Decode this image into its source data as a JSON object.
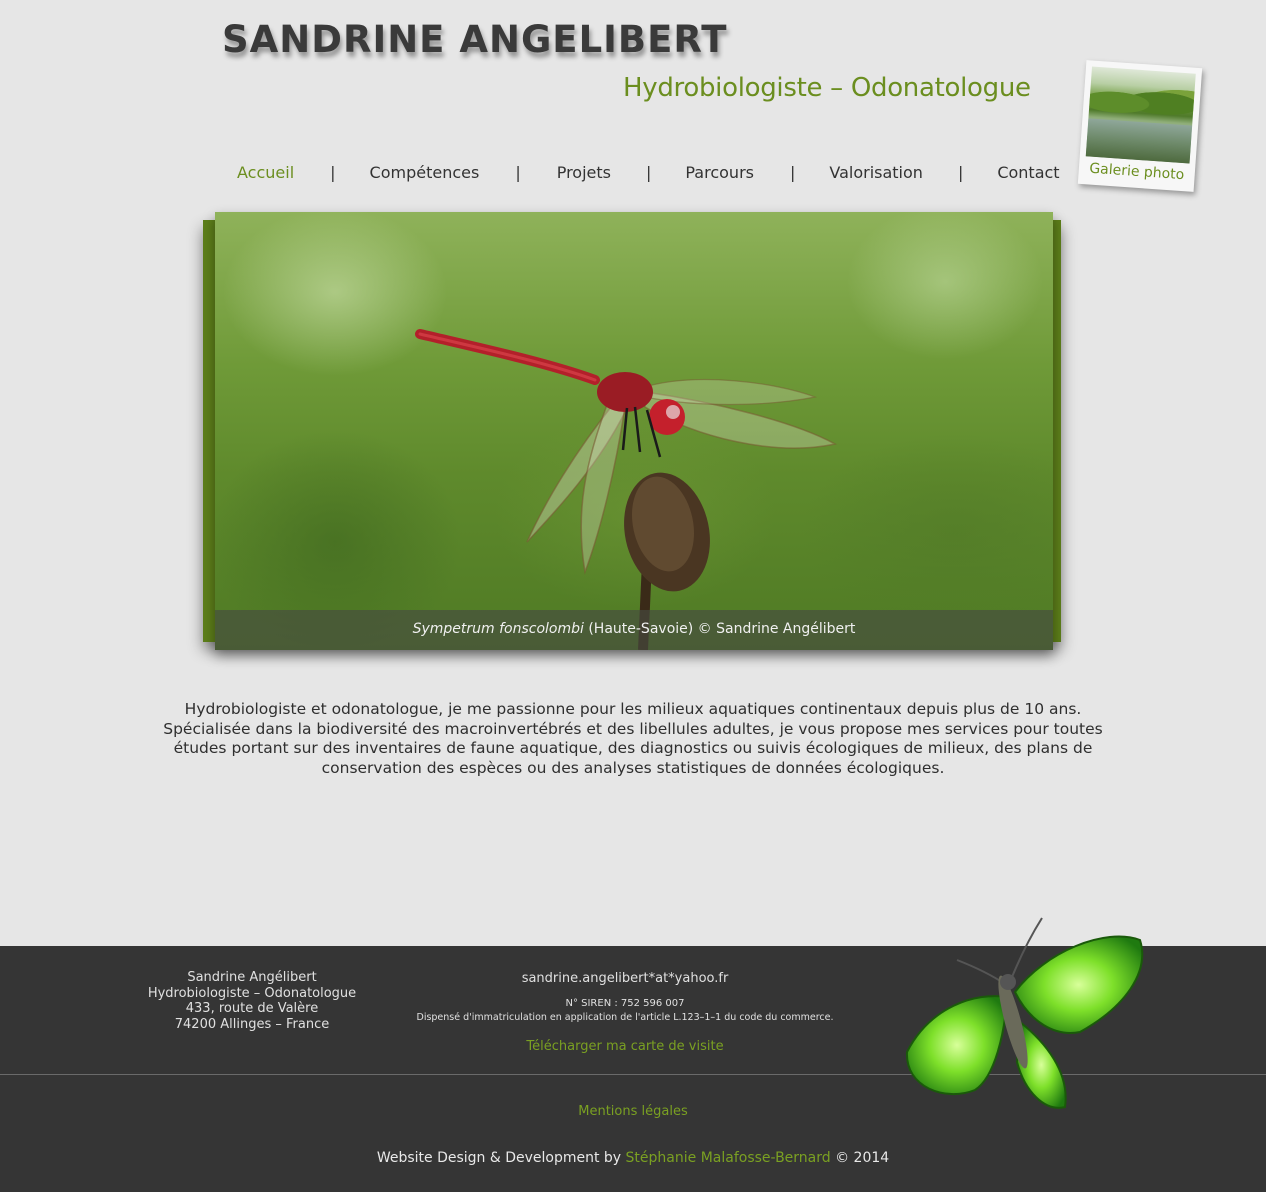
{
  "header": {
    "title": "SANDRINE ANGELIBERT",
    "subtitle": "Hydrobiologiste – Odonatologue"
  },
  "gallery": {
    "label": "Galerie photo",
    "icon": "landscape-photo"
  },
  "nav": {
    "items": [
      {
        "label": "Accueil",
        "active": true
      },
      {
        "label": "Compétences"
      },
      {
        "label": "Projets"
      },
      {
        "label": "Parcours"
      },
      {
        "label": "Valorisation"
      },
      {
        "label": "Contact"
      }
    ],
    "separator": "|"
  },
  "hero": {
    "caption_species": "Sympetrum fonscolombi",
    "caption_rest": " (Haute-Savoie) © Sandrine Angélibert"
  },
  "intro": {
    "text": "Hydrobiologiste et odonatologue, je me passionne pour les milieux aquatiques continentaux depuis plus de 10 ans. Spécialisée dans la biodiversité des macroinvertébrés et des libellules adultes, je vous propose mes services pour toutes études portant sur des inventaires de faune aquatique, des diagnostics ou suivis écologiques de milieux, des plans de conservation des espèces ou des analyses statistiques de données écologiques."
  },
  "footer": {
    "address": {
      "name": "Sandrine Angélibert",
      "role": "Hydrobiologiste – Odonatologue",
      "street": "433, route de Valère",
      "city": "74200 Allinges – France"
    },
    "email": "sandrine.angelibert*at*yahoo.fr",
    "siren": "N° SIREN : 752 596 007",
    "dispense": "Dispensé d'immatriculation en application de l'article L.123–1–1 du code du commerce.",
    "card_link": "Télécharger ma carte de visite",
    "legal_link": "Mentions légales",
    "credit_prefix": "Website Design & Development by ",
    "credit_author": "Stéphanie Malafosse-Bernard",
    "credit_suffix": " © 2014"
  },
  "colors": {
    "accent": "#6b8e1f",
    "background": "#e6e6e6",
    "footer": "#353535"
  }
}
